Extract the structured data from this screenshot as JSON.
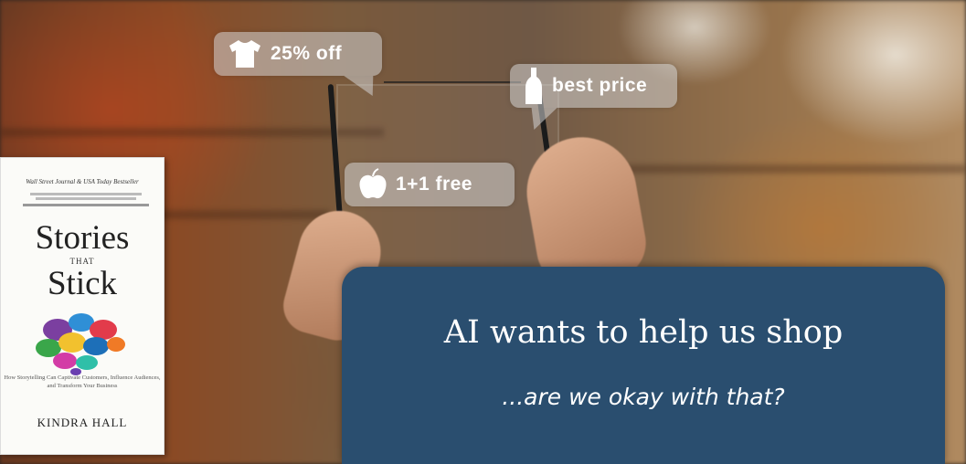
{
  "bubbles": {
    "shirt": {
      "label": "25% off",
      "icon": "tshirt-icon"
    },
    "bottle": {
      "label": "best price",
      "icon": "bottle-icon"
    },
    "apple": {
      "label": "1+1 free",
      "icon": "apple-icon"
    }
  },
  "book": {
    "tagline": "Wall Street Journal & USA Today Bestseller",
    "title_line1": "Stories",
    "title_that": "THAT",
    "title_line2": "Stick",
    "subtitle": "How Storytelling Can Captivate Customers, Influence Audiences, and Transform Your Business",
    "author": "KINDRA HALL"
  },
  "panel": {
    "headline": "AI wants to help us shop",
    "subline": "...are we okay with that?",
    "color": "#2a4e6f"
  }
}
